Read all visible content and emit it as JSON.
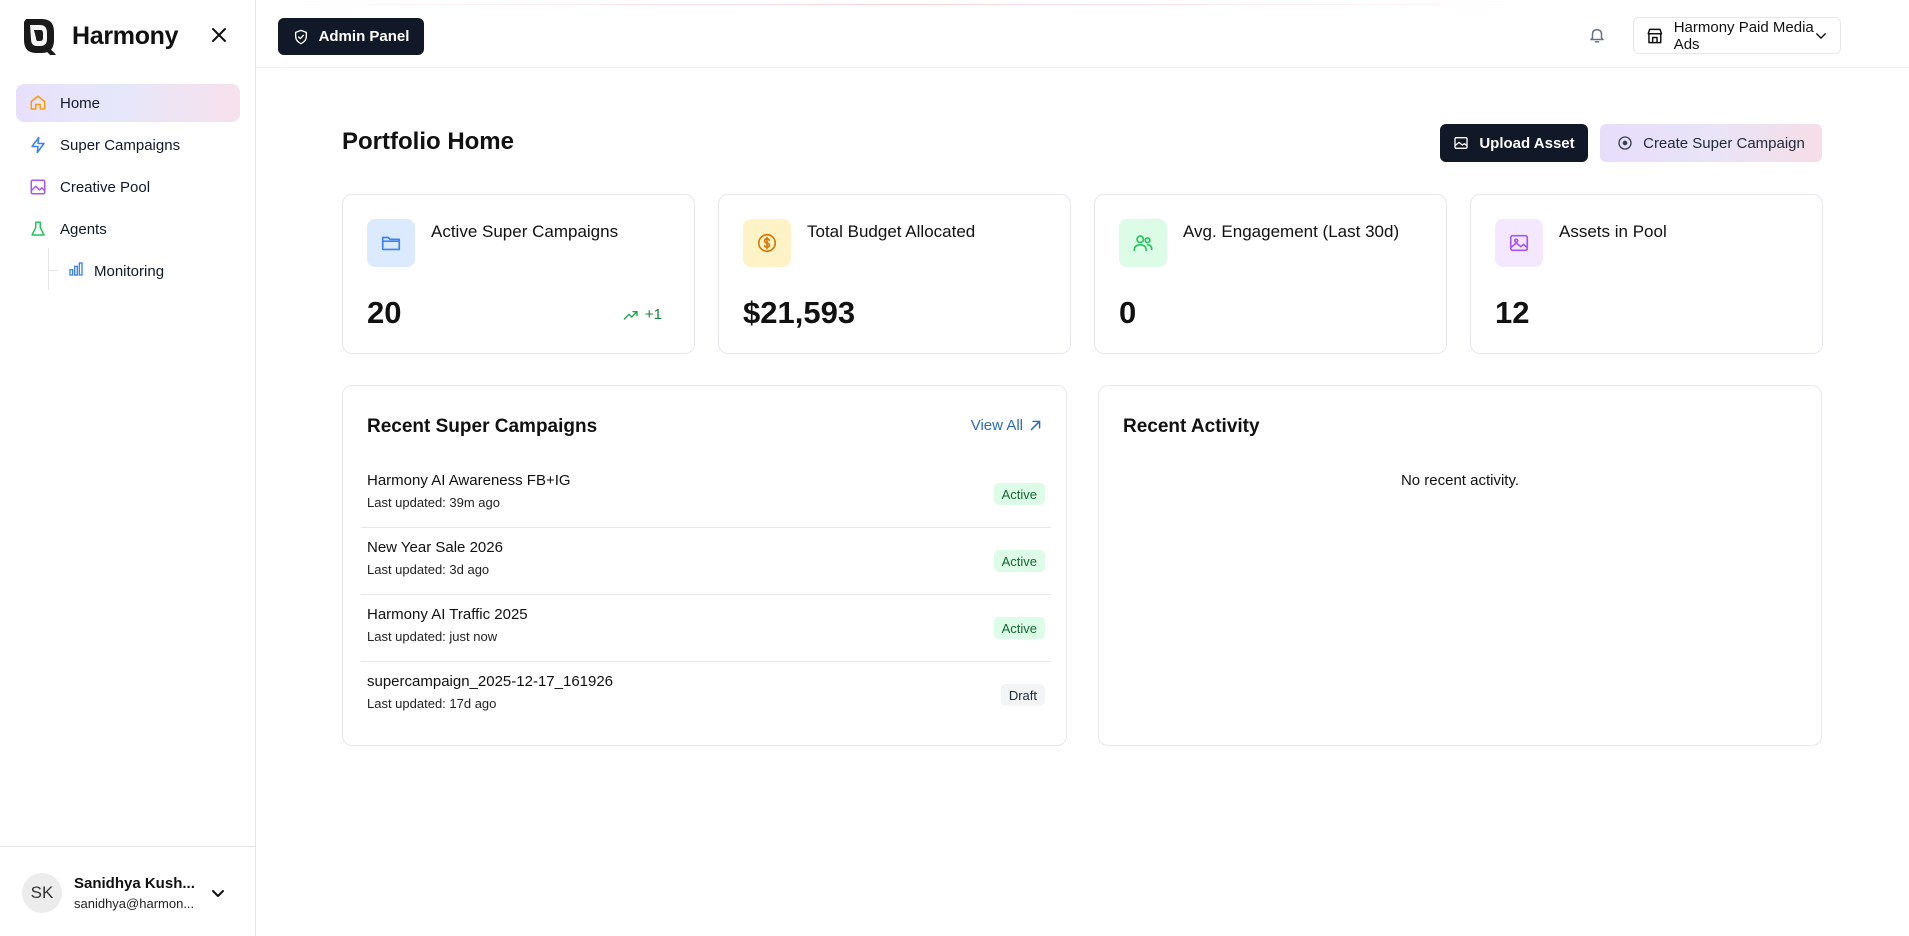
{
  "app": {
    "name": "Harmony"
  },
  "sidebar": {
    "items": [
      {
        "label": "Home",
        "icon": "home-icon",
        "active": true
      },
      {
        "label": "Super Campaigns",
        "icon": "zap-icon"
      },
      {
        "label": "Creative Pool",
        "icon": "image-icon"
      },
      {
        "label": "Agents",
        "icon": "flask-icon"
      }
    ],
    "sub_items": [
      {
        "label": "Monitoring",
        "icon": "bar-chart-icon"
      }
    ]
  },
  "user": {
    "initials": "SK",
    "name": "Sanidhya Kush...",
    "email": "sanidhya@harmon..."
  },
  "header": {
    "admin_label": "Admin Panel",
    "org_name": "Harmony Paid Media Ads"
  },
  "main": {
    "title": "Portfolio Home",
    "upload_label": "Upload Asset",
    "create_label": "Create Super Campaign"
  },
  "stats": [
    {
      "label": "Active Super Campaigns",
      "value": "20",
      "trend": "+1",
      "icon": "folder-icon",
      "color": "#3b82f6",
      "bg": "#dbeafe"
    },
    {
      "label": "Total Budget Allocated",
      "value": "$21,593",
      "icon": "dollar-coin-icon",
      "color": "#d97706",
      "bg": "#fef3c7"
    },
    {
      "label": "Avg. Engagement (Last 30d)",
      "value": "0",
      "icon": "users-icon",
      "color": "#22c55e",
      "bg": "#dcfce7"
    },
    {
      "label": "Assets in Pool",
      "value": "12",
      "icon": "image-icon",
      "color": "#a855f7",
      "bg": "#f3e8ff"
    }
  ],
  "recent_campaigns": {
    "title": "Recent Super Campaigns",
    "view_all": "View All",
    "rows": [
      {
        "name": "Harmony AI Awareness FB+IG",
        "updated": "Last updated: 39m ago",
        "status": "Active"
      },
      {
        "name": "New Year Sale 2026",
        "updated": "Last updated: 3d ago",
        "status": "Active"
      },
      {
        "name": "Harmony AI Traffic 2025",
        "updated": "Last updated: just now",
        "status": "Active"
      },
      {
        "name": "supercampaign_2025-12-17_161926",
        "updated": "Last updated: 17d ago",
        "status": "Draft"
      }
    ]
  },
  "recent_activity": {
    "title": "Recent Activity",
    "empty": "No recent activity."
  }
}
